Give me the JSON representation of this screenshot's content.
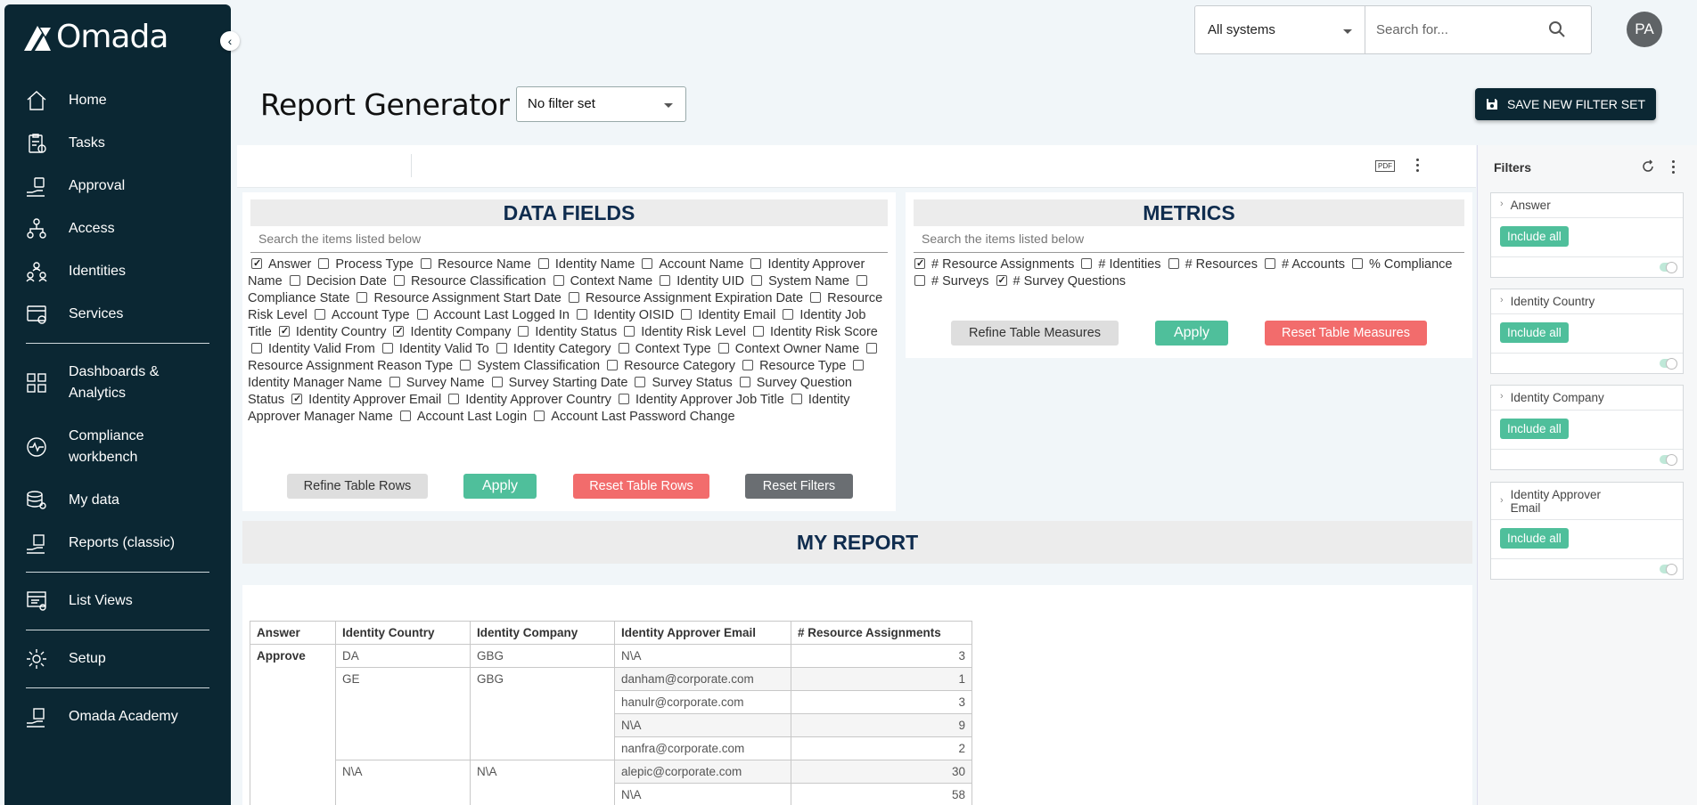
{
  "brand": {
    "name": "Omada"
  },
  "sidebar": {
    "items": [
      {
        "label": "Home"
      },
      {
        "label": "Tasks"
      },
      {
        "label": "Approval"
      },
      {
        "label": "Access"
      },
      {
        "label": "Identities"
      },
      {
        "label": "Services"
      },
      {
        "label": "Dashboards & Analytics"
      },
      {
        "label": "Compliance workbench"
      },
      {
        "label": "My data"
      },
      {
        "label": "Reports (classic)"
      },
      {
        "label": "List Views"
      },
      {
        "label": "Setup"
      },
      {
        "label": "Omada Academy"
      }
    ]
  },
  "topbar": {
    "system_select": "All systems",
    "search_placeholder": "Search for...",
    "avatar_initials": "PA"
  },
  "header": {
    "title": "Report Generator",
    "filter_set": "No filter set",
    "save_button": "SAVE NEW FILTER SET"
  },
  "toolbar": {
    "pdf_label": "PDF"
  },
  "data_fields": {
    "title": "DATA FIELDS",
    "search_placeholder": "Search the items listed below",
    "fields": [
      {
        "label": "Answer",
        "checked": true
      },
      {
        "label": "Process Type",
        "checked": false
      },
      {
        "label": "Resource Name",
        "checked": false
      },
      {
        "label": "Identity Name",
        "checked": false
      },
      {
        "label": "Account Name",
        "checked": false
      },
      {
        "label": "Identity Approver Name",
        "checked": false
      },
      {
        "label": "Decision Date",
        "checked": false
      },
      {
        "label": "Resource Classification",
        "checked": false
      },
      {
        "label": "Context Name",
        "checked": false
      },
      {
        "label": "Identity UID",
        "checked": false
      },
      {
        "label": "System Name",
        "checked": false
      },
      {
        "label": "Compliance State",
        "checked": false
      },
      {
        "label": "Resource Assignment Start Date",
        "checked": false
      },
      {
        "label": "Resource Assignment Expiration Date",
        "checked": false
      },
      {
        "label": "Resource Risk Level",
        "checked": false
      },
      {
        "label": "Account Type",
        "checked": false
      },
      {
        "label": "Account Last Logged In",
        "checked": false
      },
      {
        "label": "Identity OISID",
        "checked": false
      },
      {
        "label": "Identity Email",
        "checked": false
      },
      {
        "label": "Identity Job Title",
        "checked": false
      },
      {
        "label": "Identity Country",
        "checked": true
      },
      {
        "label": "Identity Company",
        "checked": true
      },
      {
        "label": "Identity Status",
        "checked": false
      },
      {
        "label": "Identity Risk Level",
        "checked": false
      },
      {
        "label": "Identity Risk Score",
        "checked": false
      },
      {
        "label": "Identity Valid From",
        "checked": false
      },
      {
        "label": "Identity Valid To",
        "checked": false
      },
      {
        "label": "Identity Category",
        "checked": false
      },
      {
        "label": "Context Type",
        "checked": false
      },
      {
        "label": "Context Owner Name",
        "checked": false
      },
      {
        "label": "Resource Assignment Reason Type",
        "checked": false
      },
      {
        "label": "System Classification",
        "checked": false
      },
      {
        "label": "Resource Category",
        "checked": false
      },
      {
        "label": "Resource Type",
        "checked": false
      },
      {
        "label": "Identity Manager Name",
        "checked": false
      },
      {
        "label": "Survey Name",
        "checked": false
      },
      {
        "label": "Survey Starting Date",
        "checked": false
      },
      {
        "label": "Survey Status",
        "checked": false
      },
      {
        "label": "Survey Question Status",
        "checked": false
      },
      {
        "label": "Identity Approver Email",
        "checked": true
      },
      {
        "label": "Identity Approver Country",
        "checked": false
      },
      {
        "label": "Identity Approver Job Title",
        "checked": false
      },
      {
        "label": "Identity Approver Manager Name",
        "checked": false
      },
      {
        "label": "Account Last Login",
        "checked": false
      },
      {
        "label": "Account Last Password Change",
        "checked": false
      }
    ],
    "buttons": {
      "refine": "Refine Table Rows",
      "apply": "Apply",
      "reset_rows": "Reset Table Rows",
      "reset_filters": "Reset Filters"
    }
  },
  "metrics": {
    "title": "METRICS",
    "search_placeholder": "Search the items listed below",
    "fields": [
      {
        "label": "# Resource Assignments",
        "checked": true
      },
      {
        "label": "# Identities",
        "checked": false
      },
      {
        "label": "# Resources",
        "checked": false
      },
      {
        "label": "# Accounts",
        "checked": false
      },
      {
        "label": "% Compliance",
        "checked": false
      },
      {
        "label": "# Surveys",
        "checked": false
      },
      {
        "label": "# Survey Questions",
        "checked": true
      }
    ],
    "buttons": {
      "refine": "Refine Table Measures",
      "apply": "Apply",
      "reset": "Reset Table Measures"
    }
  },
  "report": {
    "title": "MY REPORT",
    "columns": [
      "Answer",
      "Identity Country",
      "Identity Company",
      "Identity Approver Email",
      "# Resource Assignments"
    ],
    "answer": "Approve",
    "groups": [
      {
        "country": "DA",
        "company": "GBG",
        "rows": [
          {
            "email": "N\\A",
            "count": "3"
          }
        ]
      },
      {
        "country": "GE",
        "company": "GBG",
        "rows": [
          {
            "email": "danham@corporate.com",
            "count": "1"
          },
          {
            "email": "hanulr@corporate.com",
            "count": "3"
          },
          {
            "email": "N\\A",
            "count": "9"
          },
          {
            "email": "nanfra@corporate.com",
            "count": "2"
          }
        ]
      },
      {
        "country": "N\\A",
        "company": "N\\A",
        "rows": [
          {
            "email": "alepic@corporate.com",
            "count": "30"
          },
          {
            "email": "N\\A",
            "count": "58"
          }
        ]
      }
    ]
  },
  "filters": {
    "title": "Filters",
    "cards": [
      {
        "label": "Answer",
        "button": "Include all"
      },
      {
        "label": "Identity Country",
        "button": "Include all"
      },
      {
        "label": "Identity Company",
        "button": "Include all"
      },
      {
        "label": "Identity Approver Email",
        "button": "Include all"
      }
    ]
  }
}
